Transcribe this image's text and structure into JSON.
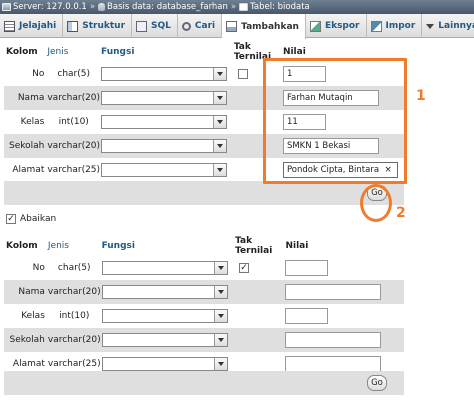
{
  "breadcrumb": {
    "server": "Server: 127.0.0.1",
    "database": "Basis data: database_farhan",
    "table": "Tabel: biodata",
    "separator": "»"
  },
  "tabs": [
    {
      "label": "Jelajahi",
      "icon": "browse-icon"
    },
    {
      "label": "Struktur",
      "icon": "structure-icon"
    },
    {
      "label": "SQL",
      "icon": "sql-icon"
    },
    {
      "label": "Cari",
      "icon": "search-icon"
    },
    {
      "label": "Tambahkan",
      "icon": "insert-icon",
      "active": true
    },
    {
      "label": "Ekspor",
      "icon": "export-icon"
    },
    {
      "label": "Impor",
      "icon": "import-icon"
    },
    {
      "label": "Lainnya",
      "icon": "chevron-down-icon"
    }
  ],
  "headers": {
    "kolom": "Kolom",
    "jenis": "Jenis",
    "fungsi": "Fungsi",
    "tak_ternilai": "Tak Ternilai",
    "nilai": "Nilai"
  },
  "form1": {
    "rows": [
      {
        "column": "No",
        "type": "char(5)",
        "function": "",
        "null_checkbox": true,
        "null_checked": false,
        "value": "1"
      },
      {
        "column": "Nama",
        "type": "varchar(20)",
        "function": "",
        "null_checkbox": false,
        "value": "Farhan Mutaqin"
      },
      {
        "column": "Kelas",
        "type": "int(10)",
        "function": "",
        "null_checkbox": false,
        "value": "11"
      },
      {
        "column": "Sekolah",
        "type": "varchar(20)",
        "function": "",
        "null_checkbox": false,
        "value": "SMKN 1 Bekasi"
      },
      {
        "column": "Alamat",
        "type": "varchar(25)",
        "function": "",
        "null_checkbox": false,
        "value": "Pondok Cipta, Bintara"
      }
    ],
    "go_label": "Go"
  },
  "ignore": {
    "label": "Abaikan",
    "checked": true
  },
  "form2": {
    "rows": [
      {
        "column": "No",
        "type": "char(5)",
        "function": "",
        "null_checkbox": true,
        "null_checked": true,
        "value": ""
      },
      {
        "column": "Nama",
        "type": "varchar(20)",
        "function": "",
        "null_checkbox": false,
        "value": ""
      },
      {
        "column": "Kelas",
        "type": "int(10)",
        "function": "",
        "null_checkbox": false,
        "value": ""
      },
      {
        "column": "Sekolah",
        "type": "varchar(20)",
        "function": "",
        "null_checkbox": false,
        "value": ""
      },
      {
        "column": "Alamat",
        "type": "varchar(25)",
        "function": "",
        "null_checkbox": false,
        "value": ""
      }
    ],
    "go_label": "Go"
  },
  "annotations": {
    "marker1": "1",
    "marker2": "2",
    "color": "#f07b2a"
  },
  "colors": {
    "link": "#235a81",
    "row_alt": "#dfdfdf",
    "breadcrumb_bg": "#5a6a7c"
  },
  "clear_glyph": "×",
  "check_glyph": "✓"
}
